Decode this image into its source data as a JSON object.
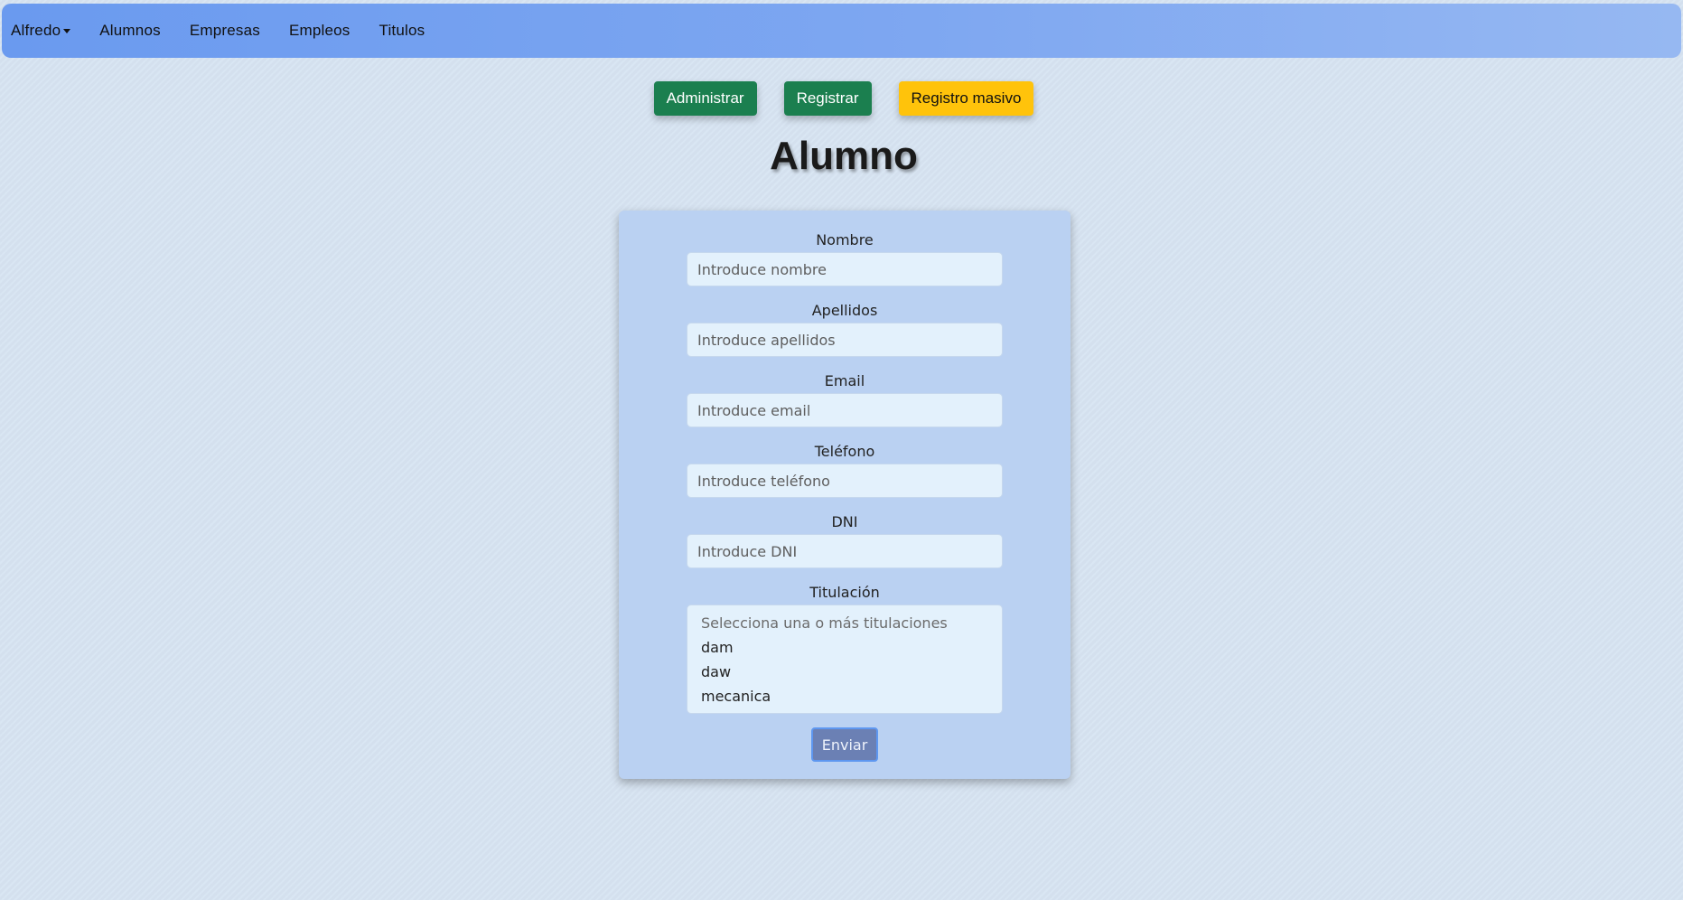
{
  "navbar": {
    "user_menu": "Alfredo",
    "links": [
      "Alumnos",
      "Empresas",
      "Empleos",
      "Titulos"
    ]
  },
  "actions": {
    "administrar": "Administrar",
    "registrar": "Registrar",
    "registro_masivo": "Registro masivo"
  },
  "page_title": "Alumno",
  "form": {
    "nombre": {
      "label": "Nombre",
      "placeholder": "Introduce nombre"
    },
    "apellidos": {
      "label": "Apellidos",
      "placeholder": "Introduce apellidos"
    },
    "email": {
      "label": "Email",
      "placeholder": "Introduce email"
    },
    "telefono": {
      "label": "Teléfono",
      "placeholder": "Introduce teléfono"
    },
    "dni": {
      "label": "DNI",
      "placeholder": "Introduce DNI"
    },
    "titulacion": {
      "label": "Titulación",
      "placeholder": "Selecciona una o más titulaciones",
      "options": [
        "dam",
        "daw",
        "mecanica"
      ]
    },
    "submit": "Enviar"
  },
  "colors": {
    "navbar_start": "#6a9aef",
    "navbar_end": "#96b8f2",
    "btn_green": "#1b7f4f",
    "btn_yellow": "#ffc30b",
    "card_bg": "#bad1f2",
    "input_bg": "#e3f1fc",
    "submit_bg": "#6b80b4"
  }
}
